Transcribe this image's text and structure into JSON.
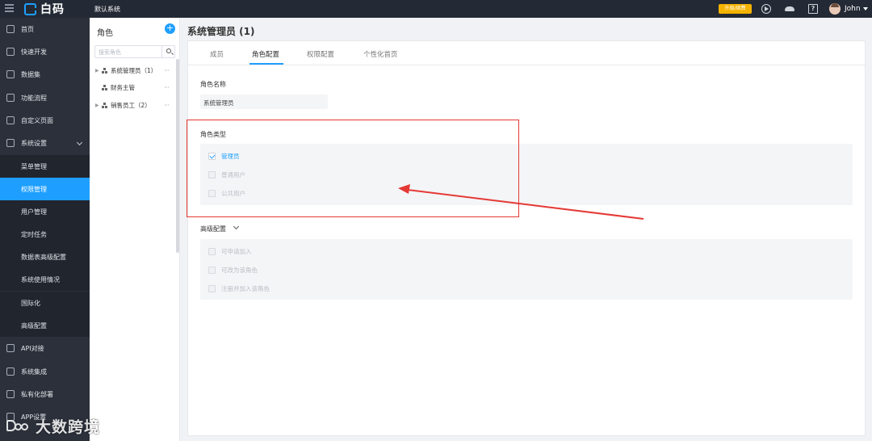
{
  "topbar": {
    "app_name": "白码",
    "system_name": "默认系统",
    "upgrade_label": "升级/续费",
    "user_name": "John"
  },
  "nav": {
    "items": [
      {
        "label": "首页",
        "icon": "home-icon"
      },
      {
        "label": "快速开发",
        "icon": "cube-icon"
      },
      {
        "label": "数据集",
        "icon": "database-icon"
      },
      {
        "label": "功能流程",
        "icon": "flow-icon"
      },
      {
        "label": "自定义页面",
        "icon": "page-icon"
      },
      {
        "label": "系统设置",
        "icon": "settings-icon"
      },
      {
        "label": "菜单管理"
      },
      {
        "label": "权限管理"
      },
      {
        "label": "用户管理"
      },
      {
        "label": "定时任务"
      },
      {
        "label": "数据表高级配置"
      },
      {
        "label": "系统使用情况"
      },
      {
        "label": "国际化"
      },
      {
        "label": "高级配置"
      },
      {
        "label": "API对接",
        "icon": "api-icon"
      },
      {
        "label": "系统集成",
        "icon": "integration-icon"
      },
      {
        "label": "私有化部署",
        "icon": "deploy-icon"
      },
      {
        "label": "APP设置",
        "icon": "app-icon"
      }
    ]
  },
  "roles": {
    "title": "角色",
    "search_placeholder": "搜索角色",
    "items": [
      {
        "label": "系统管理员（1）"
      },
      {
        "label": "财务主管"
      },
      {
        "label": "销售员工（2）"
      }
    ],
    "more_glyph": "···"
  },
  "main": {
    "title": "系统管理员 (1)",
    "tabs": [
      "成员",
      "角色配置",
      "权限配置",
      "个性化首页"
    ],
    "active_tab": "角色配置",
    "role_name_label": "角色名称",
    "role_name_value": "系统管理员",
    "role_type_label": "角色类型",
    "role_type_options": [
      {
        "label": "管理员",
        "checked": true
      },
      {
        "label": "普通用户",
        "checked": false
      },
      {
        "label": "公共用户",
        "checked": false
      }
    ],
    "advanced_label": "高级配置",
    "advanced_options": [
      {
        "label": "可申请加入",
        "checked": false
      },
      {
        "label": "可改为该角色",
        "checked": false
      },
      {
        "label": "注册并加入该角色",
        "checked": false
      }
    ]
  },
  "colors": {
    "accent": "#1e9fff",
    "annotation": "#e53935",
    "topbar": "#242a35",
    "sidebar": "#2b303b"
  },
  "watermark": {
    "text": "大数跨境"
  }
}
